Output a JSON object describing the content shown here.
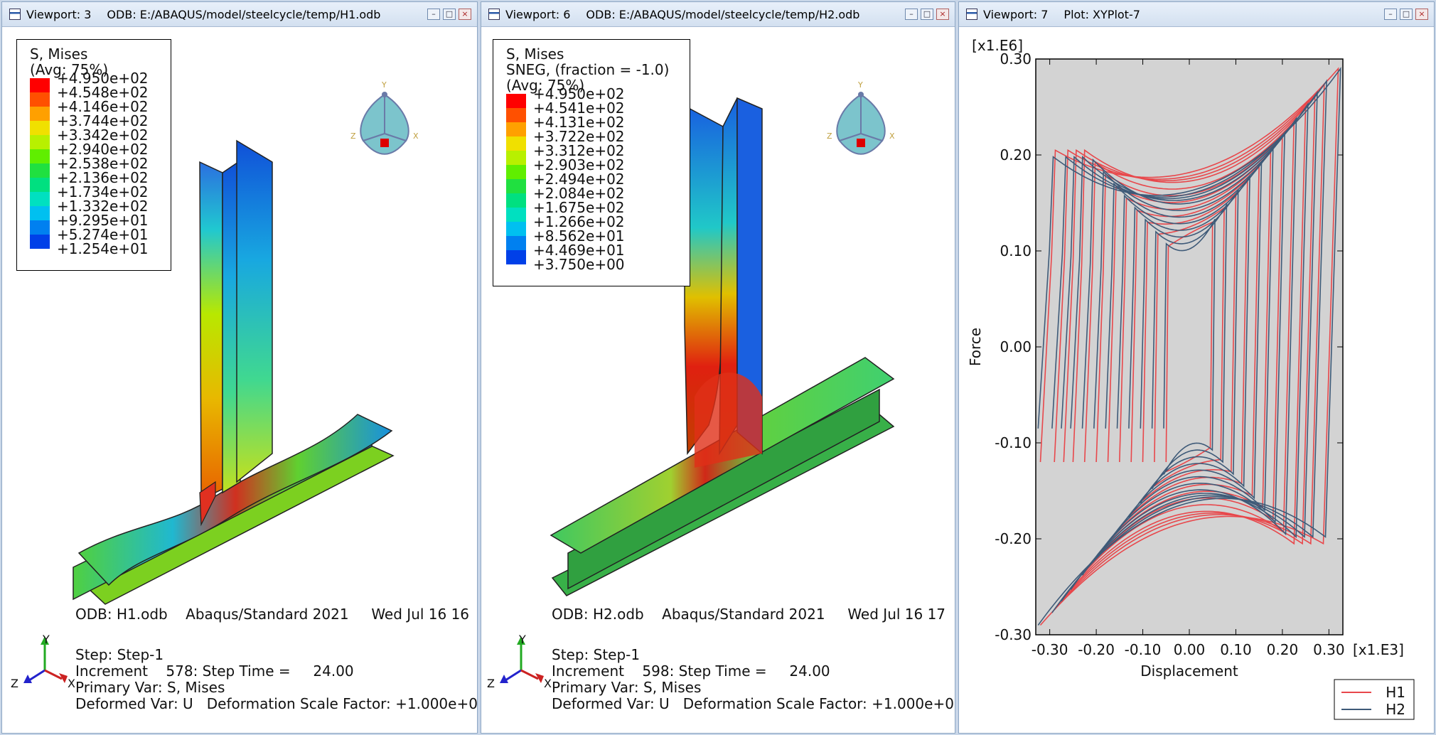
{
  "viewports": [
    {
      "title": "Viewport: 3",
      "subtitle": "ODB: E:/ABAQUS/model/steelcycle/temp/H1.odb",
      "legend": {
        "lines": [
          "S, Mises",
          "(Avg: 75%)"
        ],
        "values": [
          "+4.950e+02",
          "+4.548e+02",
          "+4.146e+02",
          "+3.744e+02",
          "+3.342e+02",
          "+2.940e+02",
          "+2.538e+02",
          "+2.136e+02",
          "+1.734e+02",
          "+1.332e+02",
          "+9.295e+01",
          "+5.274e+01",
          "+1.254e+01"
        ]
      },
      "info": {
        "line1": "ODB: H1.odb    Abaqus/Standard 2021     Wed Jul 16 16",
        "step": "Step: Step-1",
        "increment": "Increment    578: Step Time =     24.00",
        "primary": "Primary Var: S, Mises",
        "deformed": "Deformed Var: U   Deformation Scale Factor: +1.000e+0"
      }
    },
    {
      "title": "Viewport: 6",
      "subtitle": "ODB: E:/ABAQUS/model/steelcycle/temp/H2.odb",
      "legend": {
        "lines": [
          "S, Mises",
          "SNEG, (fraction = -1.0)",
          "(Avg: 75%)"
        ],
        "values": [
          "+4.950e+02",
          "+4.541e+02",
          "+4.131e+02",
          "+3.722e+02",
          "+3.312e+02",
          "+2.903e+02",
          "+2.494e+02",
          "+2.084e+02",
          "+1.675e+02",
          "+1.266e+02",
          "+8.562e+01",
          "+4.469e+01",
          "+3.750e+00"
        ]
      },
      "info": {
        "line1": "ODB: H2.odb    Abaqus/Standard 2021     Wed Jul 16 17",
        "step": "Step: Step-1",
        "increment": "Increment    598: Step Time =     24.00",
        "primary": "Primary Var: S, Mises",
        "deformed": "Deformed Var: U   Deformation Scale Factor: +1.000e+0"
      }
    }
  ],
  "plot_viewport": {
    "title": "Viewport: 7",
    "subtitle": "Plot: XYPlot-7"
  },
  "triad": {
    "y": "Y",
    "z": "Z",
    "x": "X"
  },
  "legend_colors": [
    "#ff0000",
    "#ff5000",
    "#ffa000",
    "#f0e000",
    "#b8f000",
    "#60ee00",
    "#20e040",
    "#00e080",
    "#00e0c0",
    "#00c0f0",
    "#0080f0",
    "#0040e8",
    "#0000e0"
  ],
  "colors": {
    "h1": "#e8474b",
    "h2": "#3e5a78",
    "plot_bg": "#d3d3d3"
  },
  "chart_data": {
    "type": "line",
    "xlabel": "Displacement",
    "ylabel": "Force",
    "x_multiplier": "[x1.E3]",
    "y_multiplier": "[x1.E6]",
    "xlim": [
      -0.33,
      0.33
    ],
    "ylim": [
      -0.3,
      0.3
    ],
    "xticks": [
      "-0.30",
      "-0.20",
      "-0.10",
      "0.00",
      "0.10",
      "0.20",
      "0.30"
    ],
    "yticks": [
      "0.30",
      "0.20",
      "0.10",
      "0.00",
      "-0.10",
      "-0.20",
      "-0.30"
    ],
    "legend_position": "bottom-right",
    "series": [
      {
        "name": "H1",
        "color": "#e8474b",
        "amplitudes": [
          0.05,
          0.075,
          0.1,
          0.125,
          0.15,
          0.175,
          0.2,
          0.225,
          0.25,
          0.27,
          0.29,
          0.32
        ],
        "peak": 0.205,
        "valley": 0.12
      },
      {
        "name": "H2",
        "color": "#3e5a78",
        "amplitudes": [
          0.05,
          0.075,
          0.1,
          0.125,
          0.15,
          0.175,
          0.2,
          0.225,
          0.25,
          0.27,
          0.29,
          0.32
        ],
        "peak": 0.198,
        "valley": 0.085
      }
    ]
  }
}
